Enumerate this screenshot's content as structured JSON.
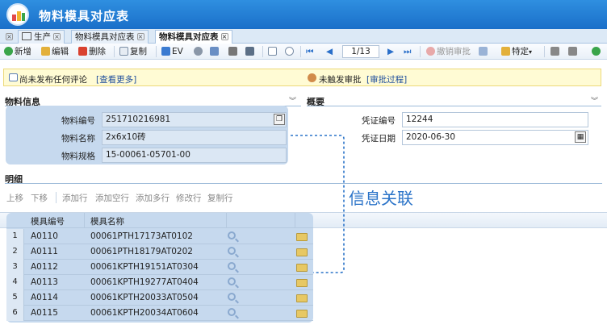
{
  "window": {
    "title": "物料模具对应表"
  },
  "tabs": [
    {
      "label": "生产",
      "active": false
    },
    {
      "label": "物料模具对应表",
      "active": false
    },
    {
      "label": "物料模具对应表",
      "active": true
    }
  ],
  "toolbar": {
    "new": "新增",
    "edit": "编辑",
    "delete": "删除",
    "copy": "复制",
    "ev": "EV",
    "page": "1/13",
    "withdraw": "撤销审批",
    "special": "特定"
  },
  "notice": {
    "comments_text": "尚未发布任何评论",
    "comments_link": "[查看更多]",
    "approval_text": "未触发审批",
    "approval_link": "[审批过程]"
  },
  "material_section": {
    "title": "物料信息",
    "fields": [
      {
        "label": "物料编号",
        "value": "251710216981"
      },
      {
        "label": "物料名称",
        "value": "2x6x10砖"
      },
      {
        "label": "物料规格",
        "value": "15-00061-05701-00"
      }
    ]
  },
  "summary_section": {
    "title": "概要",
    "fields": [
      {
        "label": "凭证编号",
        "value": "12244"
      },
      {
        "label": "凭证日期",
        "value": "2020-06-30"
      }
    ]
  },
  "detail_section": {
    "title": "明细",
    "actions": [
      "上移",
      "下移",
      "添加行",
      "添加空行",
      "添加多行",
      "修改行",
      "复制行"
    ],
    "columns": [
      "模具编号",
      "模具名称"
    ],
    "rows": [
      {
        "no": "1",
        "code": "A0110",
        "name": "00061PTH17173AT0102"
      },
      {
        "no": "2",
        "code": "A0111",
        "name": "00061PTH18179AT0202"
      },
      {
        "no": "3",
        "code": "A0112",
        "name": "00061KPTH19151AT0304"
      },
      {
        "no": "4",
        "code": "A0113",
        "name": "00061KPTH19277AT0404"
      },
      {
        "no": "5",
        "code": "A0114",
        "name": "00061KPTH20033AT0504"
      },
      {
        "no": "6",
        "code": "A0115",
        "name": "00061KPTH20034AT0604"
      }
    ]
  },
  "annotation": {
    "text": "信息关联"
  },
  "colors": {
    "titlebar": "#1a6fc9",
    "highlight": "#c6d9ee",
    "annotation": "#2a73c8"
  }
}
